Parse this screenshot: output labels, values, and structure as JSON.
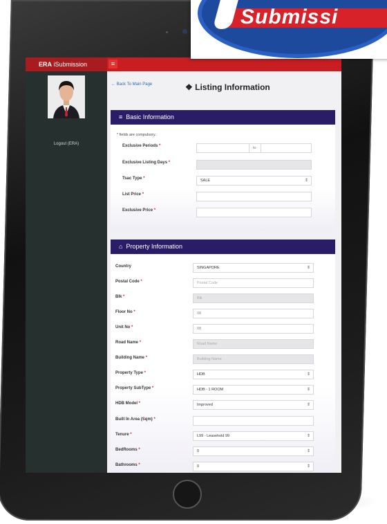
{
  "sticker": {
    "word": "Submissi"
  },
  "app": {
    "brand_bold": "ERA",
    "brand_rest": " iSubmission",
    "menu_icon": "hamburger-icon"
  },
  "sidebar": {
    "logout": "Logout (ERA)"
  },
  "page": {
    "back_link": "← Back To Main Page",
    "title": "Listing Information",
    "title_icon": "info-icon"
  },
  "basic": {
    "heading": "Basic Information",
    "heading_icon": "list-icon",
    "note": "* fields are compulsory.",
    "exclusive_periods_label": "Exclusive Periods",
    "period_to": "to",
    "listing_days_label": "Exclusive Listing Days",
    "txn_type_label": "Tsac Type",
    "txn_type_value": "SALE",
    "list_price_label": "List Price",
    "exclusive_price_label": "Exclusive Price"
  },
  "property": {
    "heading": "Property Information",
    "heading_icon": "home-icon",
    "country_label": "Country",
    "country_value": "SINGAPORE",
    "postal_label": "Postal Code",
    "postal_placeholder": "Postal Code",
    "blk_label": "Blk",
    "blk_placeholder": "Blk",
    "floor_label": "Floor No",
    "floor_value": "08",
    "unit_label": "Unit No",
    "unit_value": "08",
    "road_label": "Road Name",
    "road_placeholder": "Road Name",
    "building_label": "Building Name",
    "building_placeholder": "Building Name",
    "ptype_label": "Property Type",
    "ptype_value": "HDB",
    "psub_label": "Property SubType",
    "psub_value": "HDB - 1 ROOM",
    "model_label": "HDB Model",
    "model_value": "Improved",
    "area_label": "Built In Area (Sqm)",
    "tenure_label": "Tenure",
    "tenure_value": "L99 - Leasehold 99",
    "bed_label": "BedRooms",
    "bed_value": "0",
    "bath_label": "Bathrooms",
    "bath_value": "0"
  },
  "colors": {
    "topbar": "#c81e22",
    "sidebar": "#26302f",
    "panel_header": "#2b1c68",
    "required": "#e02222"
  }
}
